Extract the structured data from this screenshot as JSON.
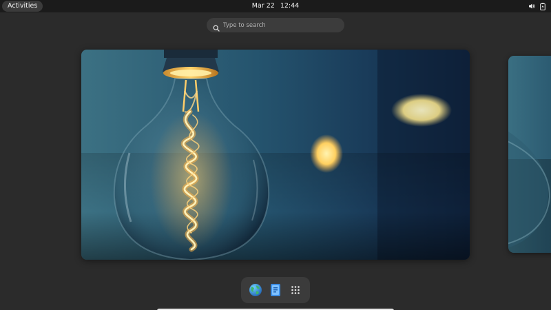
{
  "topbar": {
    "activities_label": "Activities",
    "date": "Mar 22",
    "time": "12:44",
    "tray_icons": [
      "volume-icon",
      "battery-icon"
    ]
  },
  "search": {
    "placeholder": "Type to search",
    "value": ""
  },
  "workspaces": {
    "current": 1,
    "count": 2,
    "wallpaper": "lightbulb"
  },
  "dash": {
    "apps": [
      {
        "name": "Web Browser",
        "icon": "globe-icon"
      },
      {
        "name": "Files",
        "icon": "file-manager-icon"
      },
      {
        "name": "Show Applications",
        "icon": "app-grid-icon"
      }
    ]
  },
  "colors": {
    "topbar_bg": "#1b1b1b",
    "overview_bg": "#2b2b2b",
    "search_bg": "#3c3c3c",
    "dash_bg": "#3b3b3b",
    "glow": "#ffb347"
  }
}
